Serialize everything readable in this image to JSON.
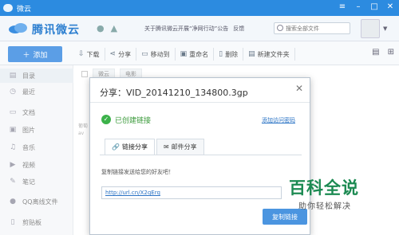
{
  "window": {
    "title": "微云"
  },
  "header": {
    "logo_text": "腾讯微云",
    "links": [
      "关于腾讯微云开展“净网行动”公告",
      "反馈"
    ],
    "search_placeholder": "搜索全部文件"
  },
  "toolbar": {
    "add_label": "添加",
    "items": [
      "下载",
      "分享",
      "移动到",
      "重命名",
      "删除",
      "新建文件夹"
    ]
  },
  "sidebar": {
    "items": [
      "目录",
      "最近",
      "文档",
      "图片",
      "音乐",
      "视频",
      "笔记",
      "QQ离线文件",
      "剪贴板"
    ]
  },
  "main": {
    "breadcrumb": [
      "微云",
      "电影"
    ],
    "snippet_lines": [
      "葡萄",
      "av"
    ]
  },
  "dialog": {
    "title": "分享：VID_20141210_134800.3gp",
    "status": "已创建链接",
    "access_link": "添加访问密码",
    "tabs": [
      "链接分享",
      "邮件分享"
    ],
    "hint": "复制链接发送给您的好友吧！",
    "link_value": "http://url.cn/X2qErq",
    "copy_button": "复制链接"
  },
  "watermark": {
    "title": "百科全说",
    "subtitle": "助你轻松解决"
  },
  "colors": {
    "titlebar": "#2c8be0",
    "accent": "#4b95e0",
    "success": "#3cb24a",
    "watermark": "#1c8a52"
  }
}
